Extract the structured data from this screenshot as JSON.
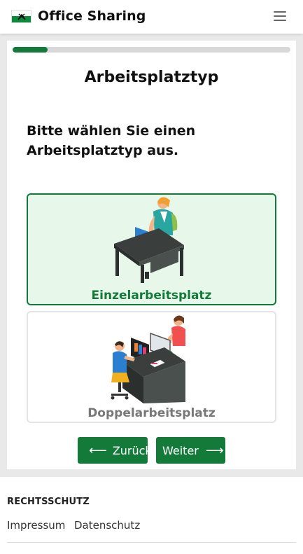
{
  "navbar": {
    "brand": "Office Sharing",
    "flag_icon": "flag-icon",
    "menu_icon": "hamburger-menu-icon"
  },
  "progress": {
    "value": 0.125
  },
  "main": {
    "title": "Arbeitsplatztyp",
    "prompt": "Bitte wählen Sie einen Arbeitsplatztyp aus.",
    "options": [
      {
        "label": "Einzelarbeitsplatz",
        "selected": true,
        "icon": "single-desk-illustration"
      },
      {
        "label": "Doppelarbeitsplatz",
        "selected": false,
        "icon": "double-desk-illustration"
      }
    ],
    "buttons": {
      "back_label": "Zurück",
      "next_label": "Weiter",
      "back_icon": "arrow-left-icon",
      "next_icon": "arrow-right-icon"
    }
  },
  "footer": {
    "heading": "RECHTSSCHUTZ",
    "links": [
      "Impressum",
      "Datenschutz"
    ]
  },
  "colors": {
    "primary": "#137a3a",
    "selected_bg": "#e7f7ea",
    "progress_track": "#d8d8d8",
    "page_bg": "#e9e9e9"
  }
}
